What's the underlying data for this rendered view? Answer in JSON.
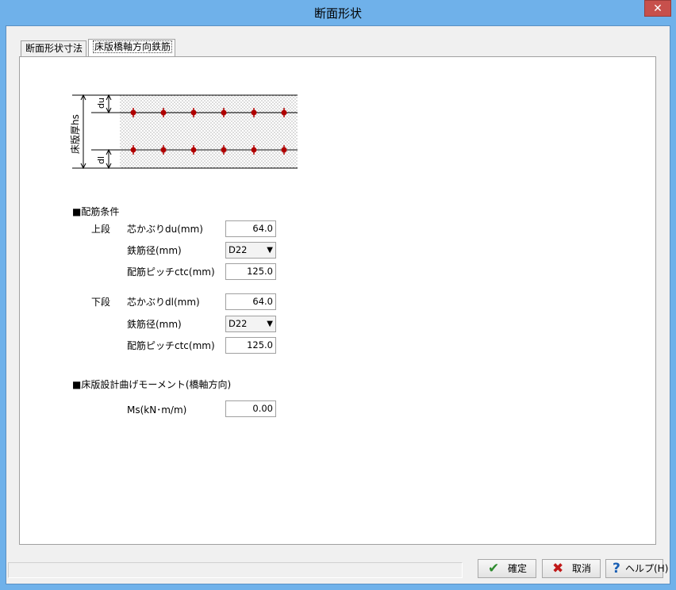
{
  "window": {
    "title": "断面形状",
    "close_glyph": "✕"
  },
  "tabs": [
    {
      "label": "断面形状寸法",
      "selected": false
    },
    {
      "label": "床版橋軸方向鉄筋",
      "selected": true
    }
  ],
  "diagram": {
    "thickness_label": "床版厚hs",
    "top_cover_label": "du",
    "bottom_cover_label": "dl",
    "bar_color": "#b00000"
  },
  "rebar_conditions": {
    "heading": "■配筋条件",
    "upper": {
      "label": "上段",
      "cover_label": "芯かぶりdu(mm)",
      "cover_value": "64.0",
      "diameter_label": "鉄筋径(mm)",
      "diameter_value": "D22",
      "pitch_label": "配筋ピッチctc(mm)",
      "pitch_value": "125.0"
    },
    "lower": {
      "label": "下段",
      "cover_label": "芯かぶりdl(mm)",
      "cover_value": "64.0",
      "diameter_label": "鉄筋径(mm)",
      "diameter_value": "D22",
      "pitch_label": "配筋ピッチctc(mm)",
      "pitch_value": "125.0"
    }
  },
  "moment": {
    "heading": "■床版設計曲げモーメント(橋軸方向)",
    "label": "Ms(kN･m/m)",
    "value": "0.00"
  },
  "buttons": {
    "ok": {
      "label": "確定",
      "icon": "check-icon",
      "color": "#2e8b2e"
    },
    "cancel": {
      "label": "取消",
      "icon": "x-icon",
      "color": "#c01818"
    },
    "help": {
      "label": "ヘルプ(H)",
      "icon": "question-icon",
      "color": "#1a5fb4"
    }
  }
}
